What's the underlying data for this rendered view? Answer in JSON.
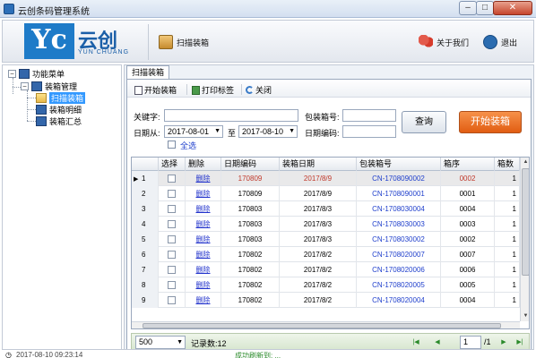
{
  "window": {
    "title": "云创条码管理系统",
    "min_glyph": "–",
    "max_glyph": "□",
    "close_glyph": "✕"
  },
  "logo": {
    "mark": "Yc",
    "name": "云创",
    "en": "YUN CHUANG"
  },
  "toolbar": {
    "scan": "扫描装箱",
    "about": "关于我们",
    "exit": "退出"
  },
  "tree": {
    "root": "功能菜单",
    "group": "装箱管理",
    "items": [
      "扫描装箱",
      "装箱明细",
      "装箱汇总"
    ],
    "selected_index": 0
  },
  "tab": {
    "label": "扫描装箱"
  },
  "subtoolbar": {
    "start": "开始装箱",
    "print": "打印标签",
    "close": "关闭"
  },
  "filters": {
    "keyword_label": "关键字:",
    "keyword_value": "",
    "boxno_label": "包装箱号:",
    "boxno_value": "",
    "date_from_label": "日期从:",
    "date_from": "2017-08-01",
    "date_to_label": "至",
    "date_to": "2017-08-10",
    "datecode_label": "日期编码:",
    "datecode_value": "",
    "select_all": "全选",
    "query_button": "查询",
    "start_button": "开始装箱"
  },
  "grid": {
    "headers": [
      "选择",
      "删除",
      "日期编码",
      "装箱日期",
      "包装箱号",
      "箱序",
      "箱数"
    ],
    "delete_label": "删除",
    "rows": [
      {
        "n": "1",
        "code": "170809",
        "date": "2017/8/9",
        "box": "CN-1708090002",
        "seq": "0002",
        "count": "1"
      },
      {
        "n": "2",
        "code": "170809",
        "date": "2017/8/9",
        "box": "CN-1708090001",
        "seq": "0001",
        "count": "1"
      },
      {
        "n": "3",
        "code": "170803",
        "date": "2017/8/3",
        "box": "CN-1708030004",
        "seq": "0004",
        "count": "1"
      },
      {
        "n": "4",
        "code": "170803",
        "date": "2017/8/3",
        "box": "CN-1708030003",
        "seq": "0003",
        "count": "1"
      },
      {
        "n": "5",
        "code": "170803",
        "date": "2017/8/3",
        "box": "CN-1708030002",
        "seq": "0002",
        "count": "1"
      },
      {
        "n": "6",
        "code": "170802",
        "date": "2017/8/2",
        "box": "CN-1708020007",
        "seq": "0007",
        "count": "1"
      },
      {
        "n": "7",
        "code": "170802",
        "date": "2017/8/2",
        "box": "CN-1708020006",
        "seq": "0006",
        "count": "1"
      },
      {
        "n": "8",
        "code": "170802",
        "date": "2017/8/2",
        "box": "CN-1708020005",
        "seq": "0005",
        "count": "1"
      },
      {
        "n": "9",
        "code": "170802",
        "date": "2017/8/2",
        "box": "CN-1708020004",
        "seq": "0004",
        "count": "1"
      }
    ],
    "selected_row_colors": {
      "code": "#c0392b",
      "date": "#c0392b",
      "box": "#1f3fcc",
      "seq": "#c0392b"
    },
    "row_marker": "▶"
  },
  "pager": {
    "page_size": "500",
    "record_count": "记录数:12",
    "current_page": "1",
    "total_pages": "/1"
  },
  "statusbar": {
    "left": "2017-08-10 09:23:14",
    "right": "成功刷新到: ..."
  }
}
